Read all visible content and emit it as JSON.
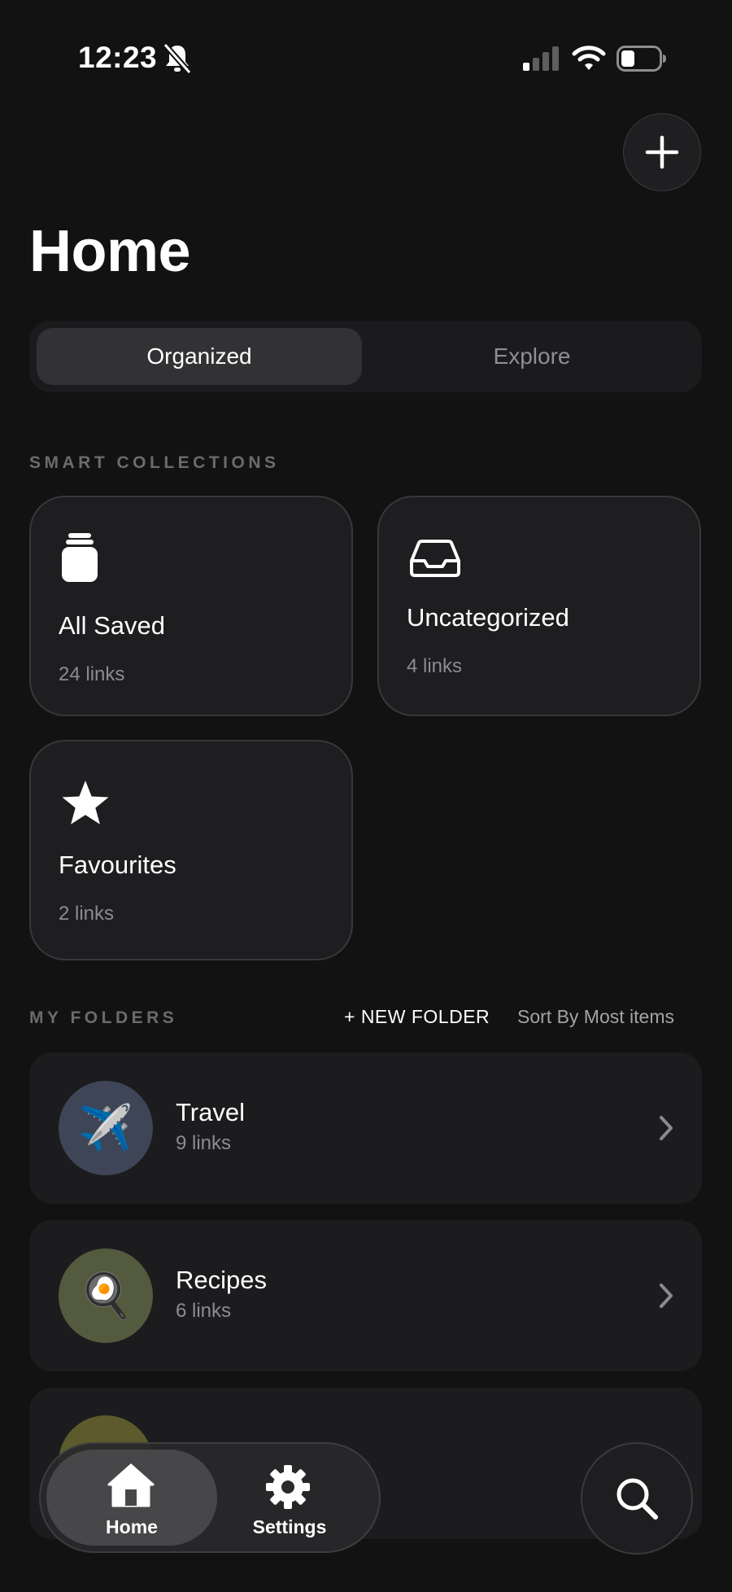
{
  "status_bar": {
    "time": "12:23",
    "icons": [
      "bell-slash-icon",
      "signal-icon",
      "wifi-icon",
      "battery-icon"
    ]
  },
  "header": {
    "title": "Home",
    "add_button_icon": "plus-icon"
  },
  "segmented_control": {
    "tabs": [
      {
        "label": "Organized",
        "selected": true
      },
      {
        "label": "Explore",
        "selected": false
      }
    ]
  },
  "smart_collections": {
    "title": "SMART COLLECTIONS",
    "items": [
      {
        "icon": "jar-icon",
        "title": "All Saved",
        "count": "24 links"
      },
      {
        "icon": "inbox-tray-icon",
        "title": "Uncategorized",
        "count": "4 links"
      },
      {
        "icon": "star-icon",
        "title": "Favourites",
        "count": "2 links"
      }
    ]
  },
  "my_folders": {
    "title": "MY FOLDERS",
    "new_folder_label": "+ NEW FOLDER",
    "sort_label": "Sort By Most items",
    "items": [
      {
        "emoji": "✈️",
        "name": "Travel",
        "count": "9 links",
        "avatar_color": "#3e4557"
      },
      {
        "emoji": "🍳",
        "name": "Recipes",
        "count": "6 links",
        "avatar_color": "#545a3d"
      }
    ]
  },
  "tab_bar": {
    "items": [
      {
        "icon": "house-icon",
        "label": "Home",
        "selected": true
      },
      {
        "icon": "gear-icon",
        "label": "Settings",
        "selected": false
      }
    ],
    "search_icon": "magnifying-glass-icon"
  },
  "colors": {
    "background": "#121213",
    "card": "#1e1e20",
    "muted_text": "#8c8c90"
  }
}
